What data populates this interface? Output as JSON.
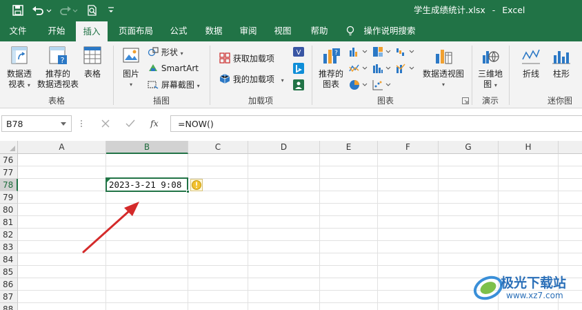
{
  "title_bar": {
    "filename": "学生成绩统计.xlsx",
    "separator": "-",
    "app_name": "Excel"
  },
  "tabs": [
    "文件",
    "开始",
    "插入",
    "页面布局",
    "公式",
    "数据",
    "审阅",
    "视图",
    "帮助",
    "操作说明搜索"
  ],
  "active_tab": "插入",
  "ribbon": {
    "pivot_table": [
      "数据透",
      "视表"
    ],
    "recommended_pivot": [
      "推荐的",
      "数据透视表"
    ],
    "table": "表格",
    "group_tables": "表格",
    "pictures": "图片",
    "shapes": "形状",
    "smartart": "SmartArt",
    "screenshot": "屏幕截图",
    "group_illustrations": "插图",
    "get_addins": "获取加载项",
    "my_addins": "我的加载项",
    "group_addins": "加载项",
    "recommended_charts": [
      "推荐的",
      "图表"
    ],
    "pivot_chart": "数据透视图",
    "group_charts": "图表",
    "map_3d": [
      "三维地",
      "图"
    ],
    "group_tours": "演示",
    "line_spark": "折线",
    "column_spark": "柱形",
    "group_sparklines": "迷你图"
  },
  "formula_bar": {
    "name_box": "B78",
    "fx": "fx",
    "formula": "=NOW()"
  },
  "grid": {
    "columns": [
      "A",
      "B",
      "C",
      "D",
      "E",
      "F",
      "G",
      "H"
    ],
    "rows": [
      "76",
      "77",
      "78",
      "79",
      "80",
      "81",
      "82",
      "83",
      "84",
      "85",
      "86",
      "87",
      "88"
    ],
    "selected_cell": "B78",
    "cell_value": "2023-3-21  9:08"
  },
  "colors": {
    "accent": "#217346",
    "arrow": "#d42a2a"
  },
  "watermark": {
    "brand": "极光下载站",
    "url": "www.xz7.com"
  }
}
